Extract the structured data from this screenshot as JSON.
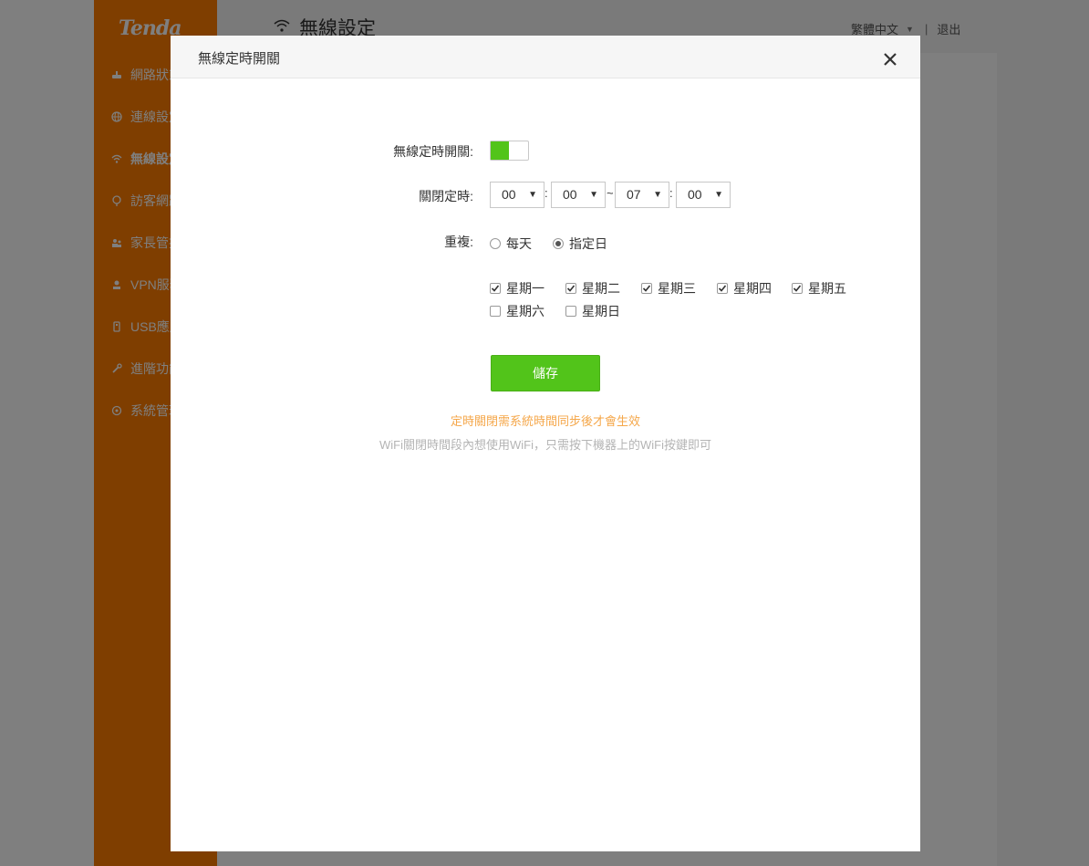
{
  "brand": {
    "logo_text": "Tenda",
    "accent": "#ff7d00",
    "green": "#52c41a"
  },
  "sidebar": {
    "items": [
      {
        "label": "網路狀態",
        "icon": "router-icon"
      },
      {
        "label": "連線設定",
        "icon": "globe-icon"
      },
      {
        "label": "無線設定",
        "icon": "wifi-icon",
        "active": true
      },
      {
        "label": "訪客網路",
        "icon": "guest-icon"
      },
      {
        "label": "家長管控",
        "icon": "parental-icon"
      },
      {
        "label": "VPN服務",
        "icon": "vpn-icon"
      },
      {
        "label": "USB應用",
        "icon": "usb-icon"
      },
      {
        "label": "進階功能",
        "icon": "wrench-icon"
      },
      {
        "label": "系統管理",
        "icon": "gear-icon"
      }
    ]
  },
  "header": {
    "title": "無線設定",
    "language": "繁體中文",
    "separator": "|",
    "logout": "退出"
  },
  "modal": {
    "title": "無線定時開關",
    "toggle_label": "無線定時開關:",
    "toggle_on": true,
    "schedule_label": "關閉定時:",
    "time": {
      "start_hour": "00",
      "start_minute": "00",
      "end_hour": "07",
      "end_minute": "00",
      "colon": ":",
      "range_sep": "~"
    },
    "repeat_label": "重複:",
    "repeat_options": [
      {
        "label": "每天",
        "selected": false
      },
      {
        "label": "指定日",
        "selected": true
      }
    ],
    "days": [
      {
        "label": "星期一",
        "checked": true
      },
      {
        "label": "星期二",
        "checked": true
      },
      {
        "label": "星期三",
        "checked": true
      },
      {
        "label": "星期四",
        "checked": true
      },
      {
        "label": "星期五",
        "checked": true
      },
      {
        "label": "星期六",
        "checked": false
      },
      {
        "label": "星期日",
        "checked": false
      }
    ],
    "save_label": "儲存",
    "note_sync": "定時關閉需系統時間同步後才會生效",
    "note_wifi": "WiFi關閉時間段內想使用WiFi，只需按下機器上的WiFi按鍵即可"
  }
}
